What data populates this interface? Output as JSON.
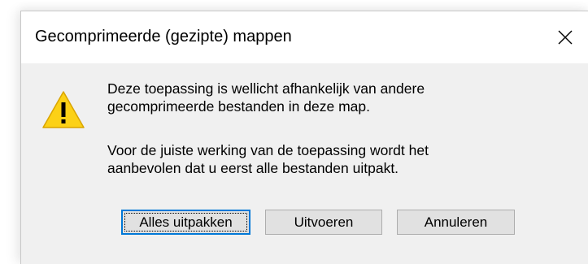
{
  "dialog": {
    "title": "Gecomprimeerde (gezipte) mappen",
    "message_line1": "Deze toepassing is wellicht afhankelijk van andere",
    "message_line2": "gecomprimeerde bestanden in deze map.",
    "message_line3": "Voor de juiste werking van de toepassing wordt het",
    "message_line4": "aanbevolen dat u eerst alle bestanden uitpakt.",
    "icon": "warning-icon",
    "close_icon": "close-icon"
  },
  "buttons": {
    "extract_all": "Alles uitpakken",
    "run": "Uitvoeren",
    "cancel": "Annuleren"
  },
  "colors": {
    "accent": "#0078d7",
    "warning_fill": "#fcd116",
    "dialog_body": "#f0f0f0",
    "button_face": "#e1e1e1"
  }
}
